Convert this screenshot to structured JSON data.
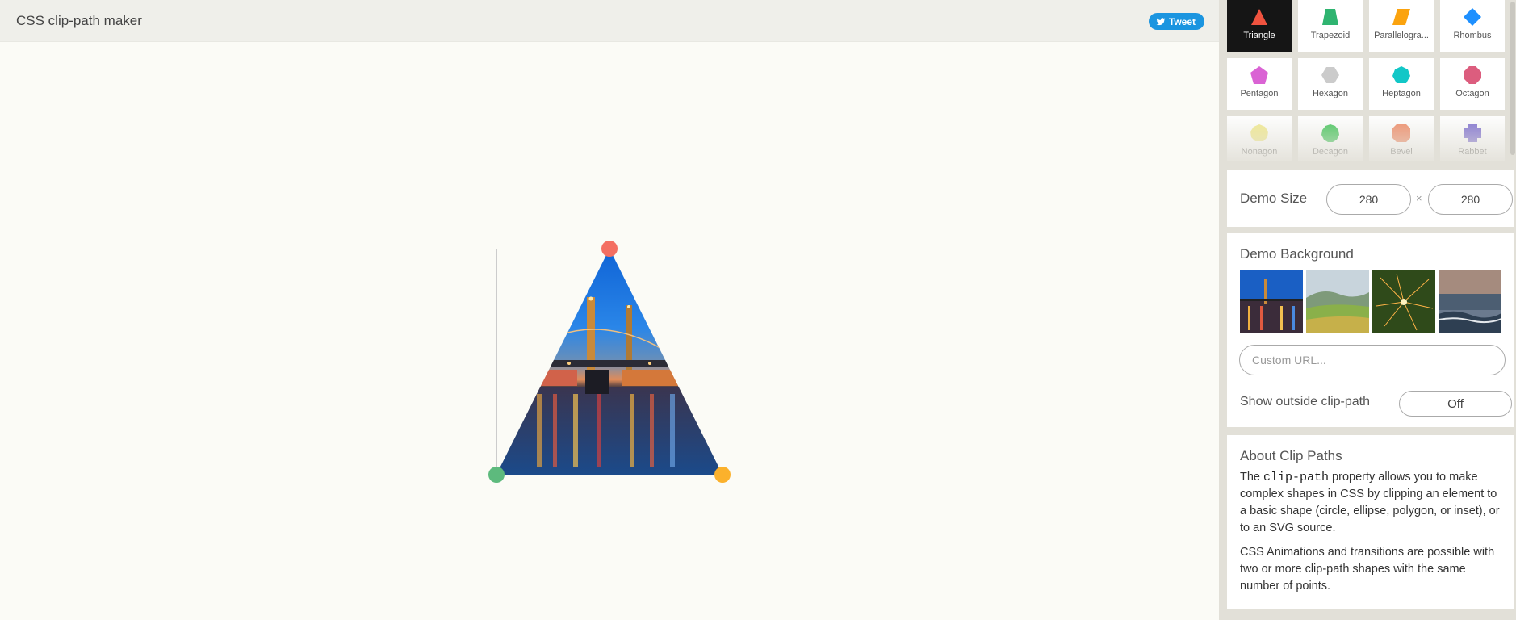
{
  "header": {
    "title": "CSS clip-path maker",
    "tweet_label": "Tweet"
  },
  "demo": {
    "shape": "triangle",
    "handle_colors": [
      "#f46f62",
      "#5dba7d",
      "#fbb12c"
    ]
  },
  "shapes": [
    {
      "label": "Triangle",
      "icon": "triangle-icon",
      "color": "#f0533f",
      "active": true
    },
    {
      "label": "Trapezoid",
      "icon": "trapezoid-icon",
      "color": "#2fb470"
    },
    {
      "label": "Parallelogra...",
      "icon": "parallelogram-icon",
      "color": "#fba30e"
    },
    {
      "label": "Rhombus",
      "icon": "rhombus-icon",
      "color": "#1e90ff"
    },
    {
      "label": "Pentagon",
      "icon": "pentagon-icon",
      "color": "#da63d4"
    },
    {
      "label": "Hexagon",
      "icon": "hexagon-icon",
      "color": "#cbcbcb"
    },
    {
      "label": "Heptagon",
      "icon": "heptagon-icon",
      "color": "#12c7c7"
    },
    {
      "label": "Octagon",
      "icon": "octagon-icon",
      "color": "#dc5d7e"
    },
    {
      "label": "Nonagon",
      "icon": "nonagon-icon",
      "color": "#f2ea8c"
    },
    {
      "label": "Decagon",
      "icon": "decagon-icon",
      "color": "#43c55a"
    },
    {
      "label": "Bevel",
      "icon": "bevel-icon",
      "color": "#f08a66"
    },
    {
      "label": "Rabbet",
      "icon": "rabbet-icon",
      "color": "#7e6fd1"
    }
  ],
  "size_panel": {
    "title": "Demo Size",
    "width": "280",
    "height": "280",
    "separator": "×"
  },
  "background_panel": {
    "title": "Demo Background",
    "thumbnails": [
      {
        "name": "bridge-night"
      },
      {
        "name": "green-hills"
      },
      {
        "name": "sparkler"
      },
      {
        "name": "ocean-sunset"
      }
    ],
    "url_placeholder": "Custom URL...",
    "outside_label": "Show outside clip-path",
    "outside_value": "Off"
  },
  "about": {
    "title": "About Clip Paths",
    "p1_before": "The ",
    "p1_code": "clip-path",
    "p1_after": " property allows you to make complex shapes in CSS by clipping an element to a basic shape (circle, ellipse, polygon, or inset), or to an SVG source.",
    "p2": "CSS Animations and transitions are possible with two or more clip-path shapes with the same number of points."
  }
}
